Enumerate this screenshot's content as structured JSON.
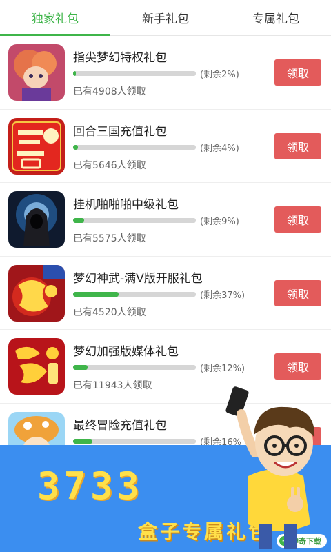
{
  "tabs": [
    {
      "label": "独家礼包",
      "active": true
    },
    {
      "label": "新手礼包",
      "active": false
    },
    {
      "label": "专属礼包",
      "active": false
    }
  ],
  "gifts": [
    {
      "title": "指尖梦幻特权礼包",
      "remaining_label": "(剩余2%)",
      "remaining_fraction": 0.02,
      "claimed_label": "已有4908人领取",
      "button": "领取",
      "icon": "fantasy-girl-game-icon"
    },
    {
      "title": "回合三国充值礼包",
      "remaining_label": "(剩余4%)",
      "remaining_fraction": 0.04,
      "claimed_label": "已有5646人领取",
      "button": "领取",
      "icon": "three-kingdoms-game-icon"
    },
    {
      "title": "挂机啪啪啪中级礼包",
      "remaining_label": "(剩余9%)",
      "remaining_fraction": 0.09,
      "claimed_label": "已有5575人领取",
      "button": "领取",
      "icon": "hooded-warrior-game-icon"
    },
    {
      "title": "梦幻神武-满V版开服礼包",
      "remaining_label": "(剩余37%)",
      "remaining_fraction": 0.37,
      "claimed_label": "已有4520人领取",
      "button": "领取",
      "icon": "menghuan-shenwu-game-icon"
    },
    {
      "title": "梦幻加强版媒体礼包",
      "remaining_label": "(剩余12%)",
      "remaining_fraction": 0.12,
      "claimed_label": "已有11943人领取",
      "button": "领取",
      "icon": "menghuan-game-icon"
    },
    {
      "title": "最终冒险充值礼包",
      "remaining_label": "(剩余16%",
      "remaining_fraction": 0.16,
      "claimed_label": "",
      "button": "领取",
      "icon": "mushroom-adventure-game-icon"
    }
  ],
  "banner": {
    "brand": "3733",
    "tagline": "盒子专属礼包",
    "watermark": "神奇下载"
  },
  "colors": {
    "accent_green": "#3fb54a",
    "claim_red": "#e35b5b",
    "banner_blue": "#3b8ef0",
    "brand_yellow": "#ffe04a"
  }
}
